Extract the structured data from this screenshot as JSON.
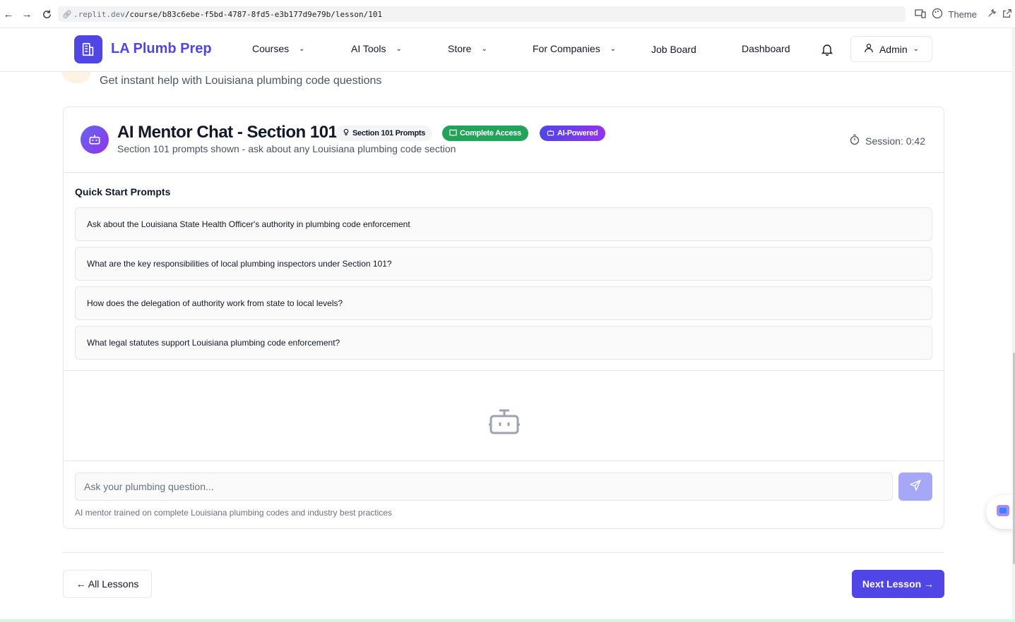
{
  "browser": {
    "url_prefix": ".replit.dev",
    "url_path": "/course/b83c6ebe-f5bd-4787-8fd5-e3b177d9e79b/lesson/101",
    "theme_label": "Theme"
  },
  "header": {
    "logo_text": "LA Plumb Prep",
    "nav": {
      "courses": "Courses",
      "ai_tools": "AI Tools",
      "store": "Store",
      "for_companies": "For Companies",
      "job_board": "Job Board",
      "dashboard": "Dashboard"
    },
    "user_label": "Admin"
  },
  "page": {
    "help_text": "Get instant help with Louisiana plumbing code questions"
  },
  "chat": {
    "title": "AI Mentor Chat - Section 101",
    "badges": {
      "prompts": "Section 101 Prompts",
      "access": "Complete Access",
      "ai": "AI-Powered"
    },
    "subtitle": "Section 101 prompts shown - ask about any Louisiana plumbing code section",
    "session": "Session: 0:42",
    "quick_start_title": "Quick Start Prompts",
    "prompts": [
      "Ask about the Louisiana State Health Officer's authority in plumbing code enforcement",
      "What are the key responsibilities of local plumbing inspectors under Section 101?",
      "How does the delegation of authority work from state to local levels?",
      "What legal statutes support Louisiana plumbing code enforcement?"
    ],
    "input_placeholder": "Ask your plumbing question...",
    "input_note": "AI mentor trained on complete Louisiana plumbing codes and industry best practices"
  },
  "footer_nav": {
    "all_lessons": "← All Lessons",
    "next_lesson": "Next Lesson →"
  },
  "colors": {
    "primary": "#4f46e5",
    "success": "#22a35a",
    "purple": "#9333ea"
  }
}
